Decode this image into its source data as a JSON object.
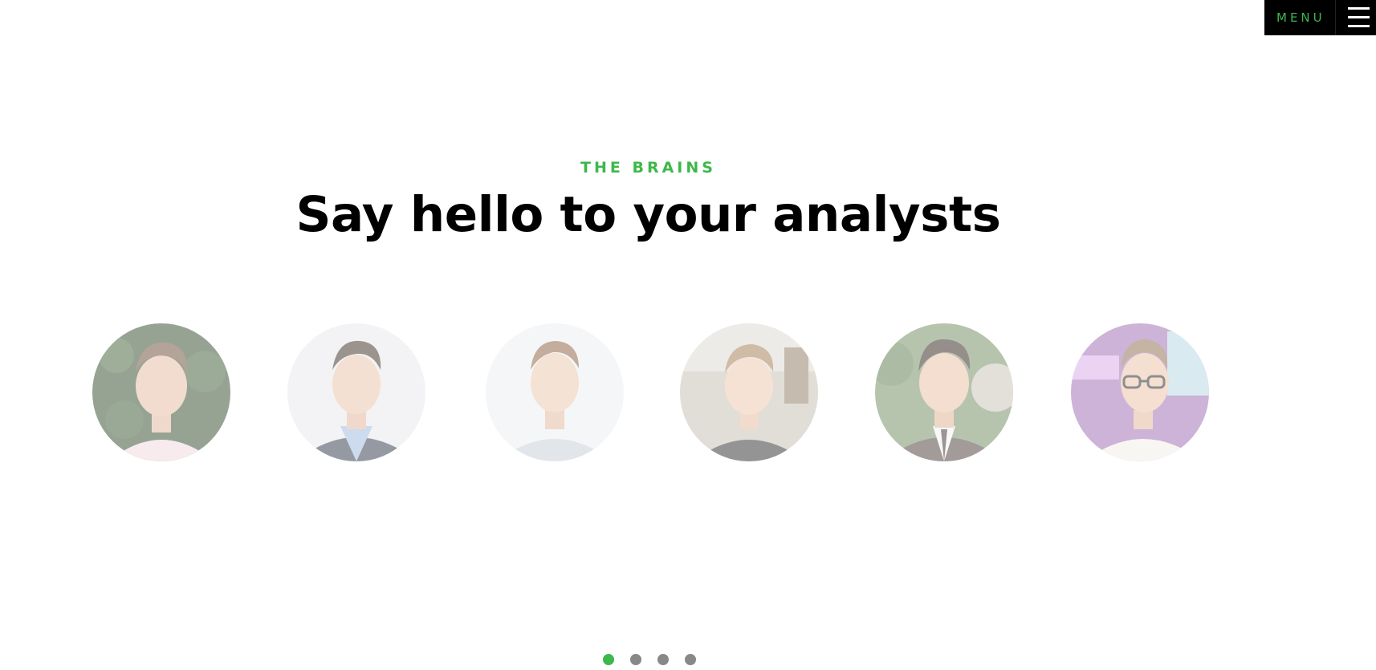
{
  "menu": {
    "label": "MENU"
  },
  "section": {
    "eyebrow": "THE BRAINS",
    "headline": "Say hello to your analysts"
  },
  "analysts": [
    {
      "icon": "analyst-photo"
    },
    {
      "icon": "analyst-photo"
    },
    {
      "icon": "analyst-photo"
    },
    {
      "icon": "analyst-photo"
    },
    {
      "icon": "analyst-photo"
    },
    {
      "icon": "analyst-photo"
    }
  ],
  "carousel": {
    "page_count": 4,
    "active_page": 1
  },
  "colors": {
    "accent": "#3db84a",
    "menu_bg": "#000000",
    "dot_inactive": "#888888"
  }
}
